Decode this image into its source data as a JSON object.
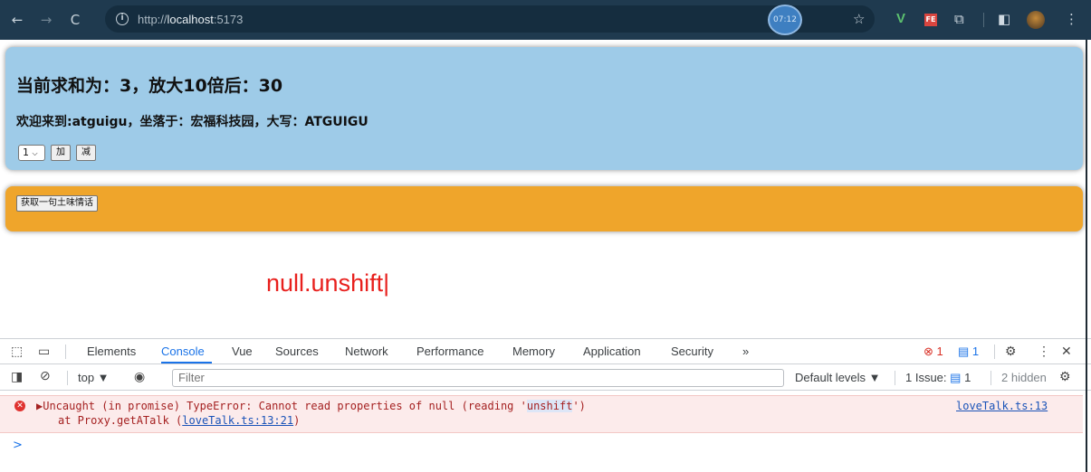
{
  "browser": {
    "url_prefix": "http://",
    "url_host": "localhost",
    "url_port": ":5173",
    "timer": "07:12"
  },
  "sum_card": {
    "title": "当前求和为：3，放大10倍后：30",
    "welcome": "欢迎来到:atguigu，坐落于：宏福科技园，大写：ATGUIGU",
    "select_value": "1",
    "add_label": "加",
    "sub_label": "减"
  },
  "talk_card": {
    "button_label": "获取一句土味情话"
  },
  "error_text": "null.unshift|",
  "devtools": {
    "tabs": [
      "Elements",
      "Console",
      "Vue",
      "Sources",
      "Network",
      "Performance",
      "Memory",
      "Application",
      "Security",
      "»"
    ],
    "active_tab": "Console",
    "error_count": "1",
    "message_count": "1",
    "context": "top ▼",
    "filter_placeholder": "Filter",
    "levels": "Default levels ▼",
    "issues_label": "1 Issue:",
    "issues_count": "1",
    "hidden_label": "2 hidden",
    "error": {
      "message_before": "▶Uncaught (in promise) TypeError: Cannot read properties of null (reading '",
      "message_highlight": "unshift",
      "message_after": "')",
      "stack_prefix": "at Proxy.getATalk (",
      "stack_link": "loveTalk.ts:13:21",
      "stack_suffix": ")",
      "source": "loveTalk.ts:13"
    },
    "prompt": ">"
  }
}
